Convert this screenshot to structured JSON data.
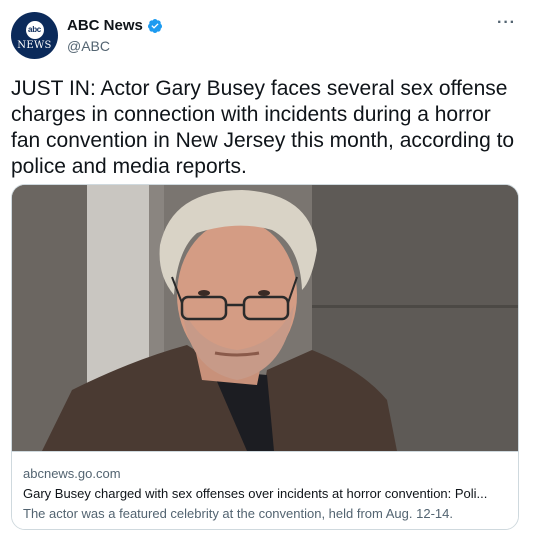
{
  "author": {
    "display_name": "ABC News",
    "handle": "@ABC",
    "avatar_logo_text": "abc",
    "avatar_wordmark": "NEWS",
    "verified": true
  },
  "tweet": {
    "text": "JUST IN: Actor Gary Busey faces several sex offense charges in connection with incidents during a horror fan convention in New Jersey this month, according to police and media reports."
  },
  "card": {
    "domain": "abcnews.go.com",
    "title": "Gary Busey charged with sex offenses over incidents at horror convention: Poli...",
    "description": "The actor was a featured celebrity at the convention, held from Aug. 12-14."
  },
  "icons": {
    "verified": "verified-badge-icon",
    "more": "more-options-icon"
  },
  "colors": {
    "verified_blue": "#1d9bf0",
    "secondary_text": "#536471",
    "border": "#cfd9de",
    "brand_navy": "#0b2a5a"
  }
}
